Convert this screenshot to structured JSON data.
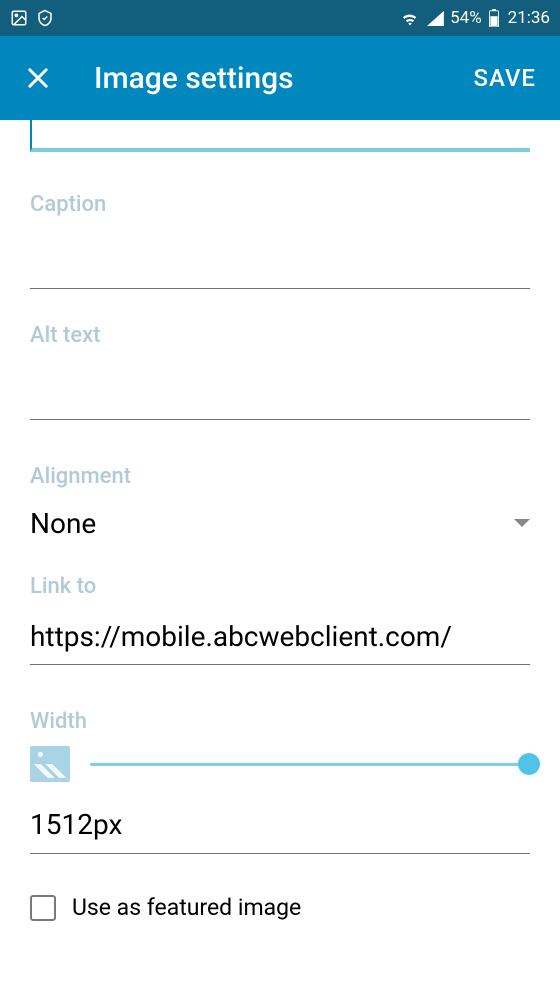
{
  "status": {
    "battery_pct": "54%",
    "time": "21:36"
  },
  "appbar": {
    "title": "Image settings",
    "save": "SAVE"
  },
  "fields": {
    "caption_label": "Caption",
    "caption_value": "",
    "alt_label": "Alt text",
    "alt_value": "",
    "alignment_label": "Alignment",
    "alignment_value": "None",
    "linkto_label": "Link to",
    "linkto_value": "https://mobile.abcwebclient.com/",
    "width_label": "Width",
    "width_value": "1512px"
  },
  "checkbox": {
    "featured_label": "Use as featured image",
    "checked": false
  }
}
